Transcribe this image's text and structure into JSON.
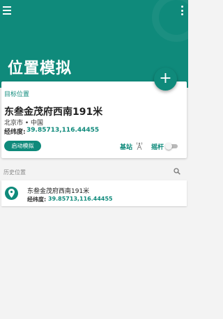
{
  "colors": {
    "primary": "#0f8a7b",
    "background": "#f3f3f3"
  },
  "header": {
    "menu_icon": "menu-icon",
    "more_icon": "more-vert-icon",
    "title": "位置模拟",
    "fab_symbol": "+"
  },
  "target": {
    "section_label": "目标位置",
    "name": "东叁金茂府西南191米",
    "city": "北京市 • 中国",
    "coord_label": "经纬度:",
    "coord_value": "39.85713,116.44455",
    "start_button": "启动模拟",
    "base_station_label": "基站",
    "base_station_icon": "antenna-icon",
    "joystick_label": "摇杆",
    "joystick_toggle": "off"
  },
  "history": {
    "label": "历史位置",
    "search_icon": "search-icon",
    "items": [
      {
        "icon": "location-pin-icon",
        "name": "东叁金茂府西南191米",
        "coord_label": "经纬度:",
        "coord_value": "39.85713,116.44455"
      }
    ]
  }
}
